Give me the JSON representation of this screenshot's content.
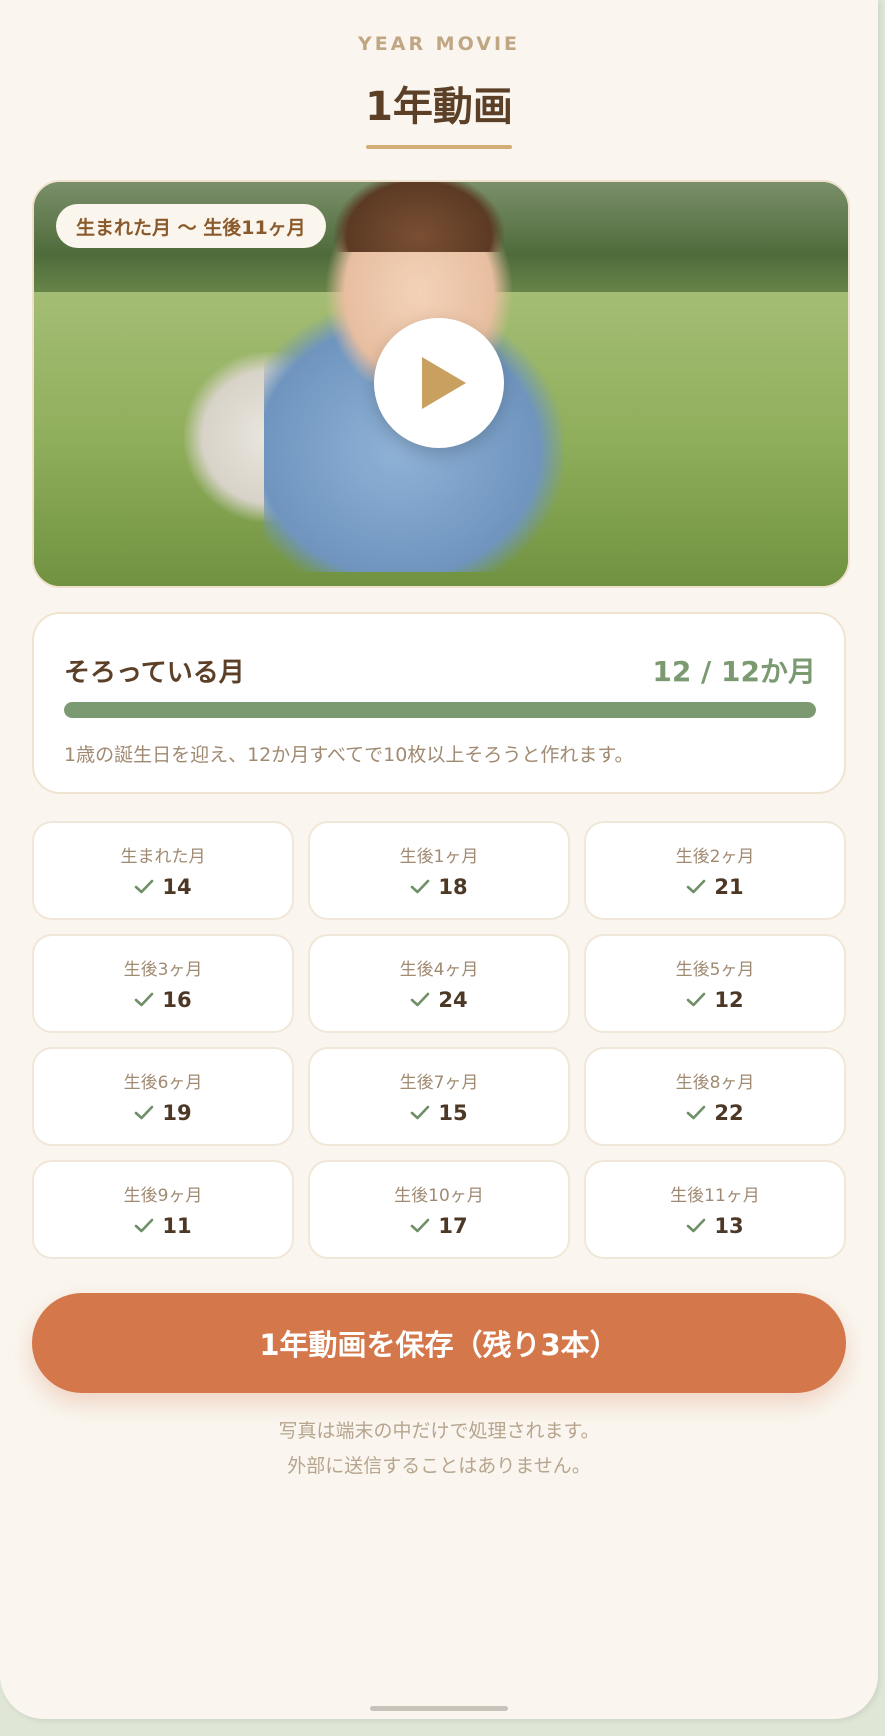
{
  "header": {
    "eyebrow": "YEAR MOVIE",
    "title": "1年動画"
  },
  "hero": {
    "range_badge": "生まれた月 〜 生後11ヶ月",
    "play_icon": "play-icon"
  },
  "progress": {
    "label": "そろっている月",
    "count": "12 / 12か月",
    "filled": 12,
    "total": 12,
    "note": "1歳の誕生日を迎え、12か月すべてで10枚以上そろうと作れます。"
  },
  "months": [
    {
      "name": "生まれた月",
      "count": "14"
    },
    {
      "name": "生後1ヶ月",
      "count": "18"
    },
    {
      "name": "生後2ヶ月",
      "count": "21"
    },
    {
      "name": "生後3ヶ月",
      "count": "16"
    },
    {
      "name": "生後4ヶ月",
      "count": "24"
    },
    {
      "name": "生後5ヶ月",
      "count": "12"
    },
    {
      "name": "生後6ヶ月",
      "count": "19"
    },
    {
      "name": "生後7ヶ月",
      "count": "15"
    },
    {
      "name": "生後8ヶ月",
      "count": "22"
    },
    {
      "name": "生後9ヶ月",
      "count": "11"
    },
    {
      "name": "生後10ヶ月",
      "count": "17"
    },
    {
      "name": "生後11ヶ月",
      "count": "13"
    }
  ],
  "actions": {
    "save_label": "1年動画を保存（残り3本）"
  },
  "privacy": {
    "line1": "写真は端末の中だけで処理されます。",
    "line2": "外部に送信することはありません。"
  },
  "colors": {
    "accent": "#d4784c",
    "progress": "#7b9a72",
    "title": "#5b3f26",
    "background": "#faf6ef"
  }
}
